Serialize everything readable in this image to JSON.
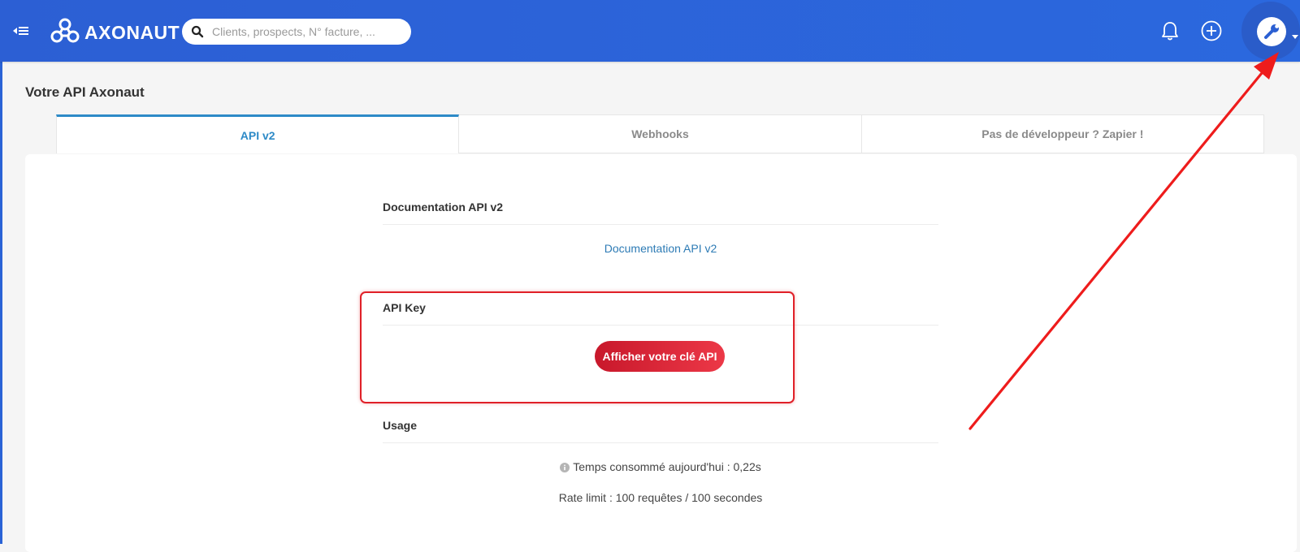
{
  "header": {
    "logo_text": "AXONAUT",
    "search": {
      "placeholder": "Clients, prospects, N° facture, ..."
    }
  },
  "page": {
    "title": "Votre API Axonaut"
  },
  "tabs": [
    {
      "label": "API v2",
      "active": true
    },
    {
      "label": "Webhooks",
      "active": false
    },
    {
      "label": "Pas de développeur ? Zapier !",
      "active": false
    }
  ],
  "documentation": {
    "section_title": "Documentation API v2",
    "link_label": "Documentation API v2"
  },
  "api_key": {
    "section_title": "API Key",
    "button_label": "Afficher votre clé API"
  },
  "usage": {
    "section_title": "Usage",
    "time_text": "Temps consommé aujourd'hui : 0,22s",
    "rate_text": "Rate limit : 100 requêtes / 100 secondes"
  },
  "colors": {
    "header": "#2c5fd4",
    "accent": "#2d8ac7",
    "button": "#d9252f",
    "annotation": "#e02028"
  },
  "icons": [
    "menu-collapse-icon",
    "axonaut-logo-icon",
    "search-icon",
    "bell-icon",
    "plus-circle-icon",
    "wrench-icon",
    "caret-down-icon",
    "info-icon"
  ]
}
